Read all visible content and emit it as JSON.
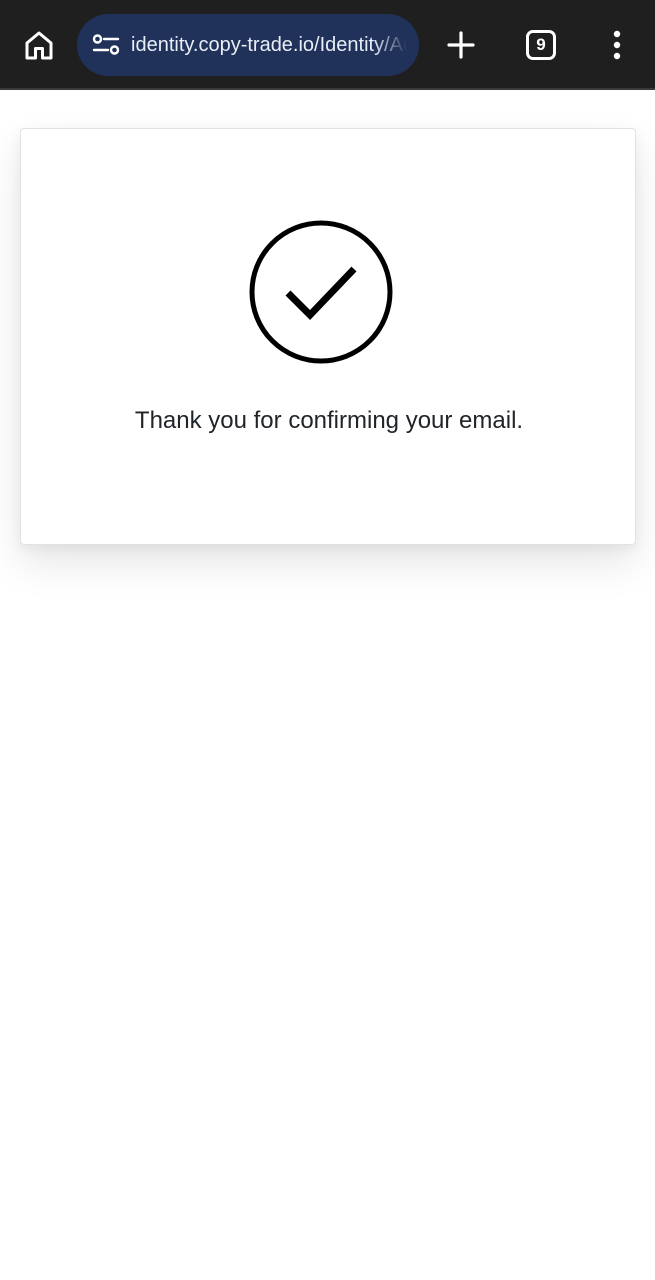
{
  "browser": {
    "url": "identity.copy-trade.io/Identity/Account/ConfirmEmail",
    "tab_count": "9",
    "icons": {
      "home": "home-icon",
      "site_info": "tune-icon",
      "new_tab": "plus-icon",
      "tabs": "tab-switcher-icon",
      "menu": "more-vert-icon"
    }
  },
  "confirmation": {
    "icon": "check-circle-icon",
    "message": "Thank you for confirming your email."
  },
  "colors": {
    "toolbar_bg": "#1f1f1f",
    "omnibox_bg": "#20315a",
    "page_bg": "#ffffff",
    "text": "#212529"
  }
}
